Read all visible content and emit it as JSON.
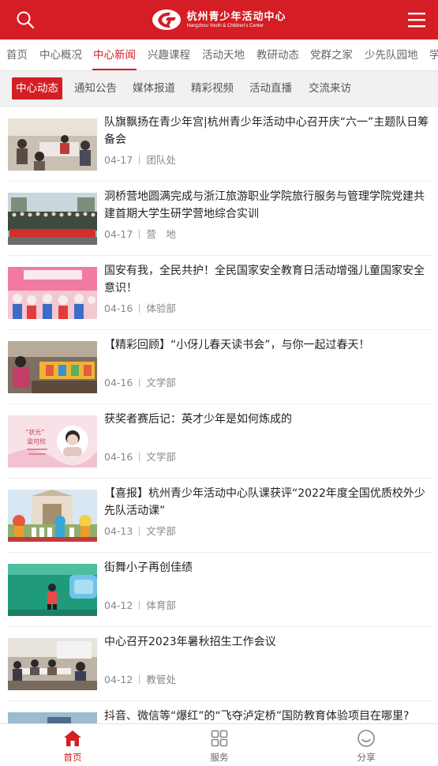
{
  "header": {
    "logo_cn": "杭州青少年活动中心",
    "logo_en": "Hangzhou Youth & Children's Center",
    "search_icon": "search-icon",
    "menu_icon": "menu-icon"
  },
  "nav_primary": [
    {
      "label": "首页"
    },
    {
      "label": "中心概况"
    },
    {
      "label": "中心新闻"
    },
    {
      "label": "兴趣课程"
    },
    {
      "label": "活动天地"
    },
    {
      "label": "教研动态"
    },
    {
      "label": "党群之家"
    },
    {
      "label": "少先队园地"
    },
    {
      "label": "学"
    }
  ],
  "nav_primary_active": "中心新闻",
  "nav_secondary": [
    {
      "label": "中心动态"
    },
    {
      "label": "通知公告"
    },
    {
      "label": "媒体报道"
    },
    {
      "label": "精彩视频"
    },
    {
      "label": "活动直播"
    },
    {
      "label": "交流来访"
    }
  ],
  "nav_secondary_active": "中心动态",
  "news": [
    {
      "title": "队旗飘扬在青少年宫|杭州青少年活动中心召开庆“六一”主题队日筹备会",
      "date": "04-17",
      "dept": "团队处"
    },
    {
      "title": "洞桥营地圆满完成与浙江旅游职业学院旅行服务与管理学院党建共建首期大学生研学营地综合实训",
      "date": "04-17",
      "dept": "营　地"
    },
    {
      "title": "国安有我，全民共护！全民国家安全教育日活动增强儿童国家安全意识！",
      "date": "04-16",
      "dept": "体验部"
    },
    {
      "title": "【精彩回顾】“小伢儿春天读书会”，与你一起过春天！",
      "date": "04-16",
      "dept": "文学部"
    },
    {
      "title": "获奖者赛后记：英才少年是如何炼成的",
      "date": "04-16",
      "dept": "文学部"
    },
    {
      "title": "【喜报】杭州青少年活动中心队课获评“2022年度全国优质校外少先队活动课”",
      "date": "04-13",
      "dept": "文学部"
    },
    {
      "title": "街舞小子再创佳绩",
      "date": "04-12",
      "dept": "体育部"
    },
    {
      "title": "中心召开2023年暑秋招生工作会议",
      "date": "04-12",
      "dept": "教管处"
    },
    {
      "title": "抖音、微信等“爆红”的“飞夺泸定桥”国防教育体验项目在哪里?",
      "date": "",
      "dept": ""
    }
  ],
  "thumb4_text": [
    "“状元”",
    "梁可欣"
  ],
  "tabbar": [
    {
      "label": "首页",
      "icon": "home-icon"
    },
    {
      "label": "服务",
      "icon": "grid-icon"
    },
    {
      "label": "分享",
      "icon": "smile-icon"
    }
  ],
  "colors": {
    "brand": "#d41d24",
    "text": "#222222",
    "meta": "#888888"
  }
}
